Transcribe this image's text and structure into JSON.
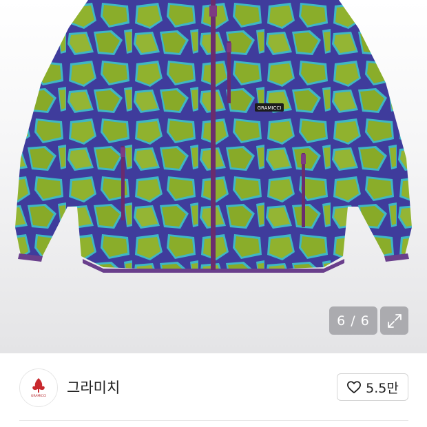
{
  "gallery": {
    "image_alt": "",
    "counter_text": "6 / 6",
    "expand_icon": "expand-icon"
  },
  "brand": {
    "name": "그라미치",
    "logo_text": "GRAMICCI",
    "like_count": "5.5만",
    "like_icon": "heart-outline-icon",
    "label_text": "GRAMICCI"
  },
  "colors": {
    "jacket_green": "#8fb02f",
    "jacket_lines": "#3e3aa0",
    "jacket_glow": "#3fb7c4",
    "zipper": "#6a2c6e"
  }
}
